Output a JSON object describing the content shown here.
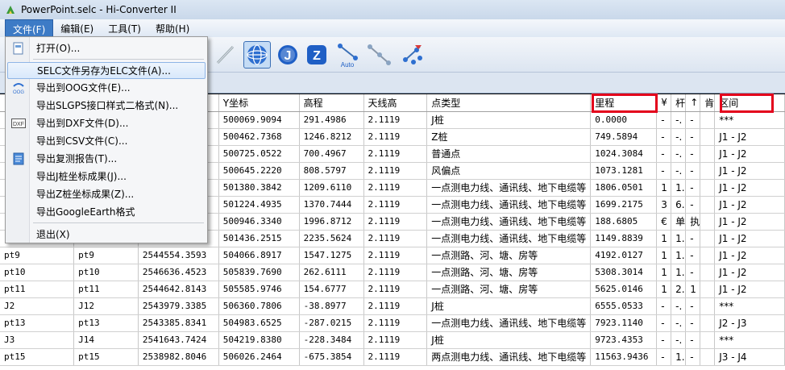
{
  "window": {
    "title": "PowerPoint.selc - Hi-Converter II"
  },
  "menubar": [
    {
      "label": "文件(F)",
      "active": true
    },
    {
      "label": "编辑(E)",
      "active": false
    },
    {
      "label": "工具(T)",
      "active": false
    },
    {
      "label": "帮助(H)",
      "active": false
    }
  ],
  "toolbar": {
    "buttons": [
      {
        "name": "line-tool-icon"
      },
      {
        "name": "globe-tool-icon"
      },
      {
        "name": "j-tool-icon",
        "text": "J"
      },
      {
        "name": "z-tool-icon",
        "text": "Z"
      },
      {
        "name": "auto-connect-icon",
        "text": "Auto"
      },
      {
        "name": "connect-nodes-icon"
      },
      {
        "name": "edit-nodes-icon"
      }
    ]
  },
  "file_menu": {
    "items": [
      {
        "label": "打开(O)...",
        "icon": "open-file-icon"
      },
      {
        "label": "SELC文件另存为ELC文件(A)...",
        "icon": "",
        "highlighted": true
      },
      {
        "label": "导出到OOG文件(E)...",
        "icon": "oog-export-icon"
      },
      {
        "label": "导出SLGPS接口样式二格式(N)...",
        "icon": ""
      },
      {
        "label": "导出到DXF文件(D)...",
        "icon": "dxf-icon"
      },
      {
        "label": "导出到CSV文件(C)...",
        "icon": ""
      },
      {
        "label": "导出复测报告(T)...",
        "icon": "report-icon"
      },
      {
        "label": "导出J桩坐标成果(J)...",
        "icon": ""
      },
      {
        "label": "导出Z桩坐标成果(Z)...",
        "icon": ""
      },
      {
        "label": "导出GoogleEarth格式",
        "icon": ""
      },
      {
        "label": "退出(X)",
        "icon": ""
      }
    ]
  },
  "table": {
    "columns": [
      "",
      "",
      "",
      "Y坐标",
      "高程",
      "天线高",
      "点类型",
      "里程",
      "¥",
      "杆",
      "↑",
      "肯",
      "区间"
    ],
    "rows": [
      [
        "",
        "",
        "",
        "500069.9094",
        "291.4986",
        "2.1119",
        "J桩",
        "0.0000",
        "-",
        "-.",
        "-",
        "",
        "***"
      ],
      [
        "",
        "",
        "",
        "500462.7368",
        "1246.8212",
        "2.1119",
        "Z桩",
        "749.5894",
        "-",
        "-.",
        "-",
        "",
        "J1 - J2"
      ],
      [
        "",
        "",
        "",
        "500725.0522",
        "700.4967",
        "2.1119",
        "普通点",
        "1024.3084",
        "-",
        "-.",
        "-",
        "",
        "J1 - J2"
      ],
      [
        "",
        "",
        "",
        "500645.2220",
        "808.5797",
        "2.1119",
        "风偏点",
        "1073.1281",
        "-",
        "-.",
        "-",
        "",
        "J1 - J2"
      ],
      [
        "",
        "",
        "",
        "501380.3842",
        "1209.6110",
        "2.1119",
        "一点测电力线、通讯线、地下电缆等",
        "1806.0501",
        "1",
        "1.",
        "-",
        "",
        "J1 - J2"
      ],
      [
        "",
        "",
        "",
        "501224.4935",
        "1370.7444",
        "2.1119",
        "一点测电力线、通讯线、地下电缆等",
        "1699.2175",
        "3",
        "6.",
        "-",
        "",
        "J1 - J2"
      ],
      [
        "",
        "",
        "",
        "500946.3340",
        "1996.8712",
        "2.1119",
        "一点测电力线、通讯线、地下电缆等",
        "188.6805",
        "€",
        "单",
        "执",
        "",
        "J1 - J2"
      ],
      [
        "",
        "",
        "",
        "501436.2515",
        "2235.5624",
        "2.1119",
        "一点测电力线、通讯线、地下电缆等",
        "1149.8839",
        "1",
        "1.",
        "-",
        "",
        "J1 - J2"
      ],
      [
        "pt9",
        "pt9",
        "2544554.3593",
        "504066.8917",
        "1547.1275",
        "2.1119",
        "一点测路、河、塘、房等",
        "4192.0127",
        "1",
        "1.",
        "-",
        "",
        "J1 - J2"
      ],
      [
        "pt10",
        "pt10",
        "2546636.4523",
        "505839.7690",
        "262.6111",
        "2.1119",
        "一点测路、河、塘、房等",
        "5308.3014",
        "1",
        "1.",
        "-",
        "",
        "J1 - J2"
      ],
      [
        "pt11",
        "pt11",
        "2544642.8143",
        "505585.9746",
        "154.6777",
        "2.1119",
        "一点测路、河、塘、房等",
        "5625.0146",
        "1",
        "2.",
        "1",
        "",
        "J1 - J2"
      ],
      [
        "J2",
        "J12",
        "2543979.3385",
        "506360.7806",
        "-38.8977",
        "2.1119",
        "J桩",
        "6555.0533",
        "-",
        "-.",
        "-",
        "",
        "***"
      ],
      [
        "pt13",
        "pt13",
        "2543385.8341",
        "504983.6525",
        "-287.0215",
        "2.1119",
        "一点测电力线、通讯线、地下电缆等",
        "7923.1140",
        "-",
        "-.",
        "-",
        "",
        "J2 - J3"
      ],
      [
        "J3",
        "J14",
        "2541643.7424",
        "504219.8380",
        "-228.3484",
        "2.1119",
        "J桩",
        "9723.4353",
        "-",
        "-.",
        "-",
        "",
        "***"
      ],
      [
        "pt15",
        "pt15",
        "2538982.8046",
        "506026.2464",
        "-675.3854",
        "2.1119",
        "两点测电力线、通讯线、地下电缆等",
        "11563.9436",
        "-",
        "1.",
        "-",
        "",
        "J3 - J4"
      ]
    ]
  },
  "annotation_color": "#e3001b"
}
